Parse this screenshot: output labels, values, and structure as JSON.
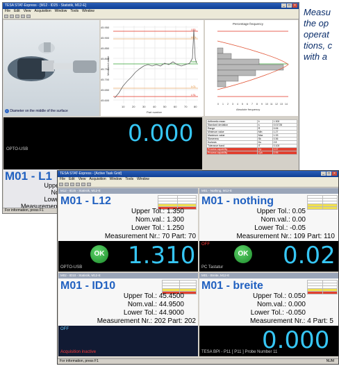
{
  "caption": {
    "lines": [
      "Measu",
      "the op",
      "operat",
      "tions, c",
      "with a"
    ]
  },
  "back_window": {
    "title": "TESA STAT-Express - [M12 - ID25 - Statistik, M12-E]",
    "menu": [
      "File",
      "Edit",
      "View",
      "Acquisition",
      "Window",
      "Tools",
      "Window"
    ],
    "image_caption": "Diameter on the middle of the surface",
    "chart": {
      "ylabel": "Measured value",
      "xlabel": "Part number",
      "xticks": [
        "10",
        "20",
        "30",
        "40",
        "50",
        "60",
        "70",
        "80"
      ],
      "yticks": [
        "45.950",
        "45.900",
        "45.850",
        "45.800",
        "45.750",
        "45.700",
        "45.650",
        "45.600"
      ],
      "labels": [
        "USL",
        "UCL",
        "Nom",
        "LCL",
        "LSL"
      ]
    },
    "histogram": {
      "title": "Percentage frequency",
      "xlabel": "Absolute frequency",
      "xticks": [
        "0",
        "1",
        "2",
        "3",
        "4",
        "5",
        "6",
        "7",
        "8",
        "9",
        "10",
        "11",
        "12",
        "13",
        "14"
      ]
    },
    "stats_table": [
      [
        "Arithmetic mean",
        "x̄",
        "1.300"
      ],
      [
        "Standard deviation",
        "s",
        "0.01726"
      ],
      [
        "Range",
        "R",
        "0.06"
      ],
      [
        "Minimum value",
        "Min",
        "1.27"
      ],
      [
        "Maximum value",
        "Max",
        "1.33"
      ],
      [
        "Skewness",
        "Sk",
        "0.36"
      ],
      [
        "Kurtosis",
        "Ku",
        "2.8"
      ],
      [
        "Tolerance band",
        "IT",
        "0.100"
      ],
      [
        "Process capability",
        "Cp",
        "0.97"
      ],
      [
        "Process capability",
        "Cpk",
        "0.95"
      ]
    ],
    "readout": "0.000",
    "device": "OPTO-USB",
    "partial_name": "M01 - L1",
    "partial_info": [
      "Uppe",
      "No",
      "Lowe",
      "Measurement"
    ],
    "status": "For information, press F1"
  },
  "front_window": {
    "title": "TESA STAT-Express - [Active Task Grid]",
    "menu": [
      "File",
      "Edit",
      "View",
      "Acquisition",
      "Window",
      "Tools",
      "Window"
    ],
    "status": "For information, press F1",
    "status_right": "NUM",
    "panels": [
      {
        "bar": "M12 - ID25 - Statistik, M12-E",
        "name": "M01 - L12",
        "upper": "Upper Tol.: 1.350",
        "nom": "Nom.val.: 1.300",
        "lower": "Lower Tol.: 1.250",
        "meas": "Measurement Nr.: 70 Part: 70",
        "ok": "OK",
        "readout": "1.310",
        "device": "OPTO-USB"
      },
      {
        "bar": "M01 - Nothing, M12-E",
        "name": "M01 - nothing",
        "upper": "Upper Tol.: 0.05",
        "nom": "Nom.val.: 0.00",
        "lower": "Lower Tol.: -0.05",
        "meas": "Measurement Nr.: 109 Part: 110",
        "ok": "OK",
        "readout": "0.02",
        "device": "PC Tastatur",
        "off": "OFF"
      },
      {
        "bar": "M02 - ID10 - Statistik, M12-E",
        "name": "M01 - ID10",
        "upper": "Upper Tol.: 45.4500",
        "nom": "Nom.val.: 44.9500",
        "lower": "Lower Tol.: 44.9000",
        "meas": "Measurement Nr.: 202 Part: 202",
        "device": "Acquisition inactive",
        "off": "OFF"
      },
      {
        "bar": "M01 - Breite, M12-E",
        "name": "M01 - breite",
        "upper": "Upper Tol.: 0.050",
        "nom": "Nom.val.: 0.000",
        "lower": "Lower Tol.: -0.050",
        "meas": "Measurement Nr.: 4 Part: 5",
        "readout": "0.000",
        "device": "TESA BPI - P11 [ P11 ] Probe Number 11"
      }
    ]
  },
  "colors": {
    "readout": "#36c6f4",
    "name": "#2060c0",
    "ok": "#2ea83a",
    "usl": "#e03020",
    "nom": "#30a030"
  }
}
